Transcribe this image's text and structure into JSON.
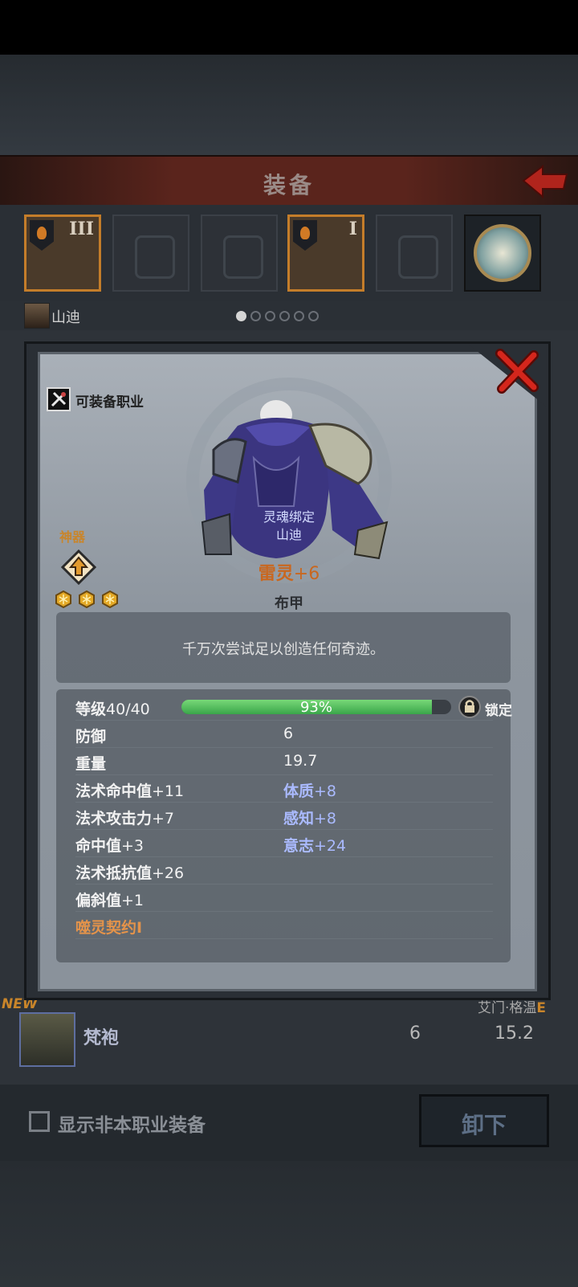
{
  "header": {
    "title": "装备"
  },
  "slots": [
    {
      "tier": "III",
      "filled": true
    },
    {
      "tier": "",
      "filled": false
    },
    {
      "tier": "",
      "filled": false
    },
    {
      "tier": "I",
      "filled": true
    },
    {
      "tier": "",
      "filled": false
    }
  ],
  "character": {
    "name": "山迪",
    "page_count": 6,
    "page_active": 1
  },
  "dialog": {
    "class_label": "可装备职业",
    "soulbound_line1": "灵魂绑定",
    "soulbound_line2": "山迪",
    "artifact_label": "神器",
    "artifact_gems": 3,
    "item_name": "雷灵",
    "item_plus": "+6",
    "item_type": "布甲",
    "description": "千万次尝试足以创造任何奇迹。",
    "level_label": "等级",
    "level_value": "40/40",
    "xp_percent_text": "93%",
    "xp_fraction": 0.93,
    "lock_label": "锁定",
    "stats": [
      {
        "label": "防御",
        "value": "6"
      },
      {
        "label": "重量",
        "value": "19.7"
      }
    ],
    "bonuses": [
      {
        "left_label": "法术命中值",
        "left_val": "+11",
        "right_label": "体质",
        "right_val": "+8"
      },
      {
        "left_label": "法术攻击力",
        "left_val": "+7",
        "right_label": "感知",
        "right_val": "+8"
      },
      {
        "left_label": "命中值",
        "left_val": "+3",
        "right_label": "意志",
        "right_val": "+24"
      },
      {
        "left_label": "法术抵抗值",
        "left_val": "+26",
        "right_label": "",
        "right_val": ""
      },
      {
        "left_label": "偏斜值",
        "left_val": "+1",
        "right_label": "",
        "right_val": ""
      }
    ],
    "enchant": "噬灵契约I"
  },
  "background_list": {
    "new_tag": "NEW",
    "item_name": "梵袍",
    "item_val1": "6",
    "item_val2": "15.2",
    "owner": "艾门·格温",
    "owner_grade": "E"
  },
  "bottom": {
    "checkbox_label": "显示非本职业装备",
    "unequip_label": "卸下"
  },
  "colors": {
    "accent": "#c9852a",
    "xp_bar": "#3aa64a",
    "header": "#5a241c"
  }
}
